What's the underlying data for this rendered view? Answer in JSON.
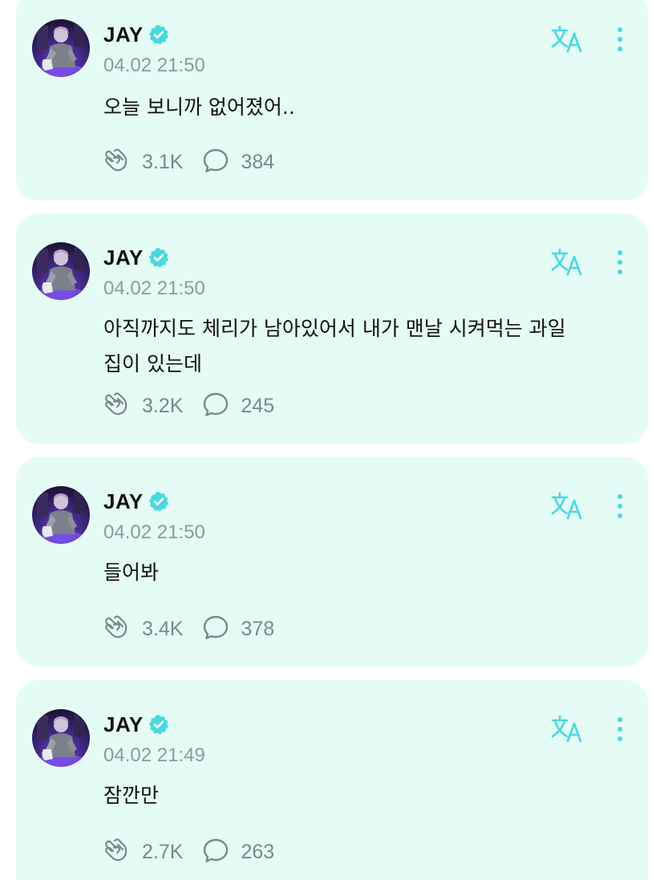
{
  "colors": {
    "card_background": "#e5fbf6",
    "accent": "#49d8df",
    "muted_text": "#8e9a9a",
    "icon": "#7c8888"
  },
  "icons": {
    "verified": "verified-badge-icon",
    "translate": "translate-icon",
    "more": "more-vertical-icon",
    "like": "heart-hands-icon",
    "comment": "comment-bubble-icon"
  },
  "posts": [
    {
      "author": "JAY",
      "timestamp": "04.02 21:50",
      "text": "오늘 보니까 없어졌어..",
      "likes": "3.1K",
      "comments": "384"
    },
    {
      "author": "JAY",
      "timestamp": "04.02 21:50",
      "text": "아직까지도 체리가 남아있어서 내가 맨날 시켜먹는 과일\n집이 있는데",
      "likes": "3.2K",
      "comments": "245"
    },
    {
      "author": "JAY",
      "timestamp": "04.02 21:50",
      "text": "들어봐",
      "likes": "3.4K",
      "comments": "378"
    },
    {
      "author": "JAY",
      "timestamp": "04.02 21:49",
      "text": "잠깐만",
      "likes": "2.7K",
      "comments": "263"
    }
  ]
}
